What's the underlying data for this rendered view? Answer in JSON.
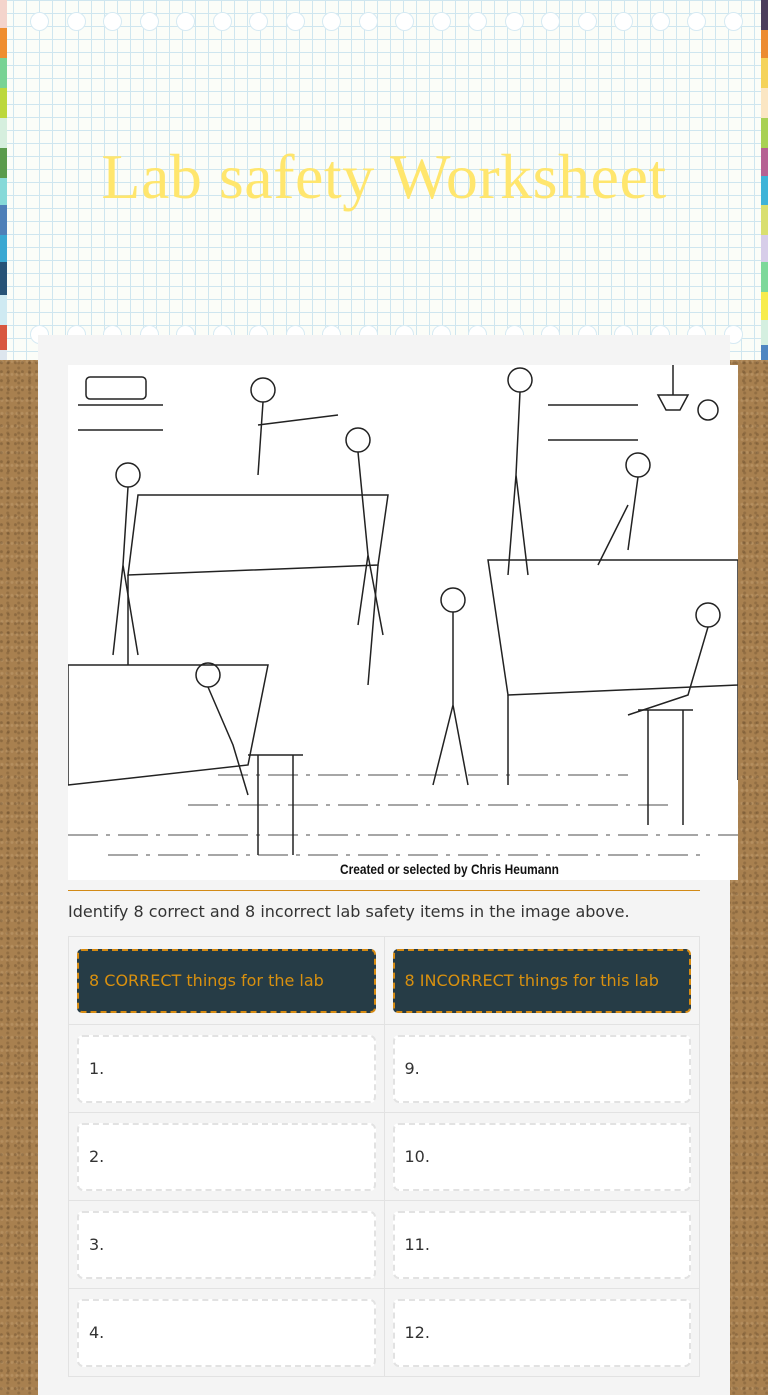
{
  "header": {
    "title": "Lab safety Worksheet"
  },
  "image": {
    "description": "Line drawing of students in a science lab",
    "caption": "Created or selected by Chris Heumann"
  },
  "instructions": "Identify 8 correct and 8 incorrect lab safety items in the image above.",
  "table": {
    "headers": [
      "8 CORRECT things for the lab",
      "8 INCORRECT things for this lab"
    ],
    "rows": [
      [
        "1.",
        "9."
      ],
      [
        "2.",
        "10."
      ],
      [
        "3.",
        "11."
      ],
      [
        "4.",
        "12."
      ]
    ]
  },
  "colors": {
    "accent": "#d8900f",
    "header_bg": "#263c46",
    "title": "#ffe66d"
  }
}
